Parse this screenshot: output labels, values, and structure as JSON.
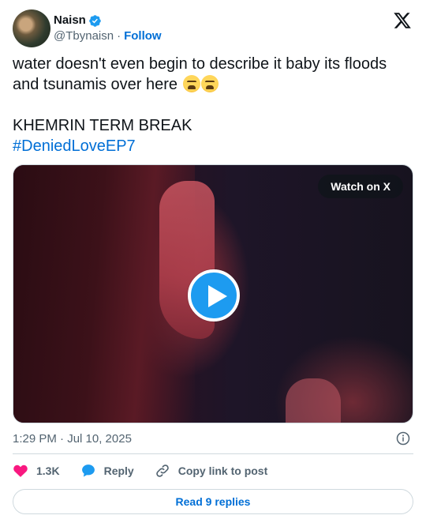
{
  "author": {
    "name": "Naisn",
    "handle": "@Tbynaisn",
    "separator": "·",
    "follow_label": "Follow"
  },
  "tweet": {
    "line1": "water doesn't even begin to describe it baby its floods and tsunamis over here",
    "emojis": [
      "weary-face",
      "tired-face"
    ],
    "line2": "KHEMRIN TERM BREAK",
    "hashtag": "#DeniedLoveEP7"
  },
  "media": {
    "watch_label": "Watch on X"
  },
  "meta": {
    "timestamp": "1:29 PM · Jul 10, 2025"
  },
  "actions": {
    "likes": "1.3K",
    "reply_label": "Reply",
    "copy_label": "Copy link to post"
  },
  "footer": {
    "read_replies_label": "Read 9 replies"
  },
  "colors": {
    "link": "#006fd6",
    "like": "#f91880",
    "reply": "#1d9bf0",
    "play": "#1d9bf0",
    "verified": "#1d9bf0"
  },
  "icons": [
    "verified-badge-icon",
    "x-logo-icon",
    "play-icon",
    "info-icon",
    "heart-icon",
    "reply-bubble-icon",
    "link-icon"
  ]
}
